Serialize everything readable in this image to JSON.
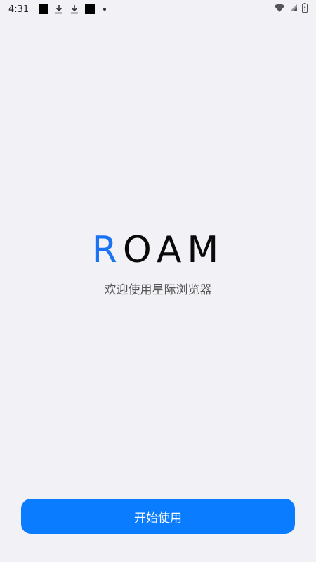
{
  "status_bar": {
    "time": "4:31",
    "icons": [
      "notification-square",
      "download-icon",
      "download-icon",
      "notification-square",
      "dot-icon"
    ],
    "right_icons": [
      "wifi-icon",
      "signal-icon",
      "battery-icon"
    ]
  },
  "logo": {
    "first_letter": "R",
    "rest": "OAM",
    "accent_color": "#1a73f2",
    "text_color": "#0a0a0a"
  },
  "subtitle": "欢迎使用星际浏览器",
  "start_button": {
    "label": "开始使用",
    "color": "#0a7cff"
  }
}
